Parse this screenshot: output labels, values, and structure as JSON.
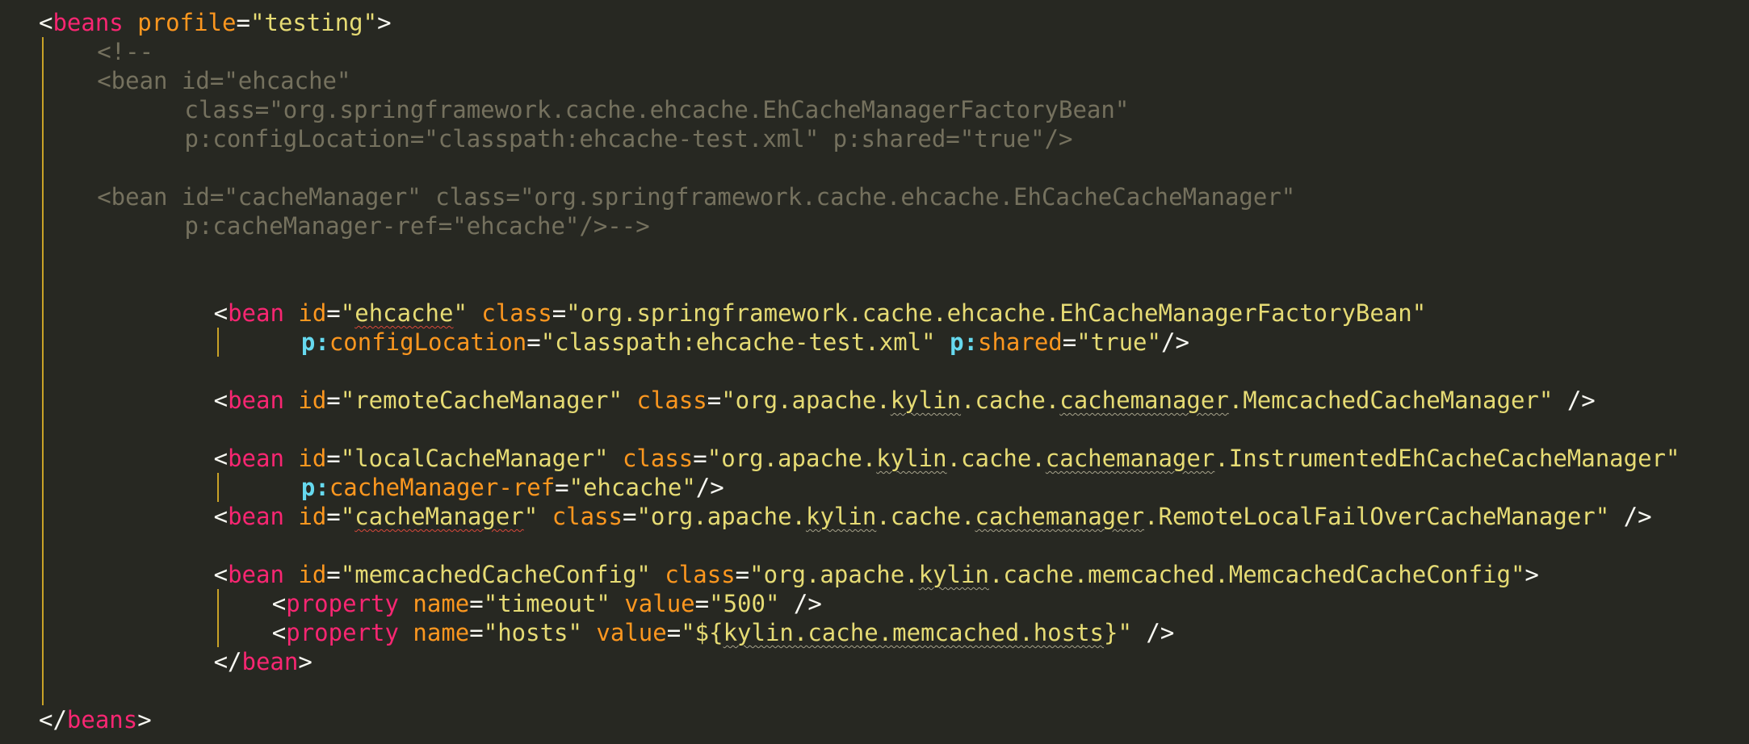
{
  "lines": [
    {
      "indent": 0,
      "tokens": [
        [
          "p",
          "<"
        ],
        [
          "t",
          "beans"
        ],
        [
          "p",
          " "
        ],
        [
          "a",
          "profile"
        ],
        [
          "p",
          "="
        ],
        [
          "s",
          "\"testing\""
        ],
        [
          "p",
          ">"
        ]
      ]
    },
    {
      "indent": 4,
      "tokens": [
        [
          "c",
          "<!--"
        ]
      ]
    },
    {
      "indent": 4,
      "tokens": [
        [
          "c",
          "<bean id=\"ehcache\""
        ]
      ]
    },
    {
      "indent": 10,
      "tokens": [
        [
          "c",
          "class=\"org.springframework.cache.ehcache.EhCacheManagerFactoryBean\""
        ]
      ]
    },
    {
      "indent": 10,
      "tokens": [
        [
          "c",
          "p:configLocation=\"classpath:ehcache-test.xml\" p:shared=\"true\"/>"
        ]
      ]
    },
    {
      "indent": 0,
      "tokens": []
    },
    {
      "indent": 4,
      "tokens": [
        [
          "c",
          "<bean id=\"cacheManager\" class=\"org.springframework.cache.ehcache.EhCacheCacheManager\""
        ]
      ]
    },
    {
      "indent": 10,
      "tokens": [
        [
          "c",
          "p:cacheManager-ref=\"ehcache\"/>-->"
        ]
      ]
    },
    {
      "indent": 0,
      "tokens": []
    },
    {
      "indent": 0,
      "tokens": []
    },
    {
      "indent": 12,
      "tokens": [
        [
          "p",
          "<"
        ],
        [
          "t",
          "bean"
        ],
        [
          "p",
          " "
        ],
        [
          "a",
          "id"
        ],
        [
          "p",
          "="
        ],
        [
          "s",
          "\""
        ],
        [
          "s sqr",
          "ehcache"
        ],
        [
          "s",
          "\""
        ],
        [
          "p",
          " "
        ],
        [
          "a",
          "class"
        ],
        [
          "p",
          "="
        ],
        [
          "s",
          "\"org.springframework.cache.ehcache.EhCacheManagerFactoryBean\""
        ]
      ]
    },
    {
      "indent": 18,
      "tokens": [
        [
          "n",
          "p:"
        ],
        [
          "a",
          "configLocation"
        ],
        [
          "p",
          "="
        ],
        [
          "s",
          "\"classpath:ehcache-test.xml\""
        ],
        [
          "p",
          " "
        ],
        [
          "n",
          "p:"
        ],
        [
          "a",
          "shared"
        ],
        [
          "p",
          "="
        ],
        [
          "s",
          "\"true\""
        ],
        [
          "p",
          "/>"
        ]
      ]
    },
    {
      "indent": 0,
      "tokens": []
    },
    {
      "indent": 12,
      "tokens": [
        [
          "p",
          "<"
        ],
        [
          "t",
          "bean"
        ],
        [
          "p",
          " "
        ],
        [
          "a",
          "id"
        ],
        [
          "p",
          "="
        ],
        [
          "s",
          "\"remoteCacheManager\""
        ],
        [
          "p",
          " "
        ],
        [
          "a",
          "class"
        ],
        [
          "p",
          "="
        ],
        [
          "s",
          "\"org.apache."
        ],
        [
          "s sq",
          "kylin"
        ],
        [
          "s",
          ".cache."
        ],
        [
          "s sq",
          "cachemanager"
        ],
        [
          "s",
          ".MemcachedCacheManager\""
        ],
        [
          "p",
          " />"
        ]
      ]
    },
    {
      "indent": 0,
      "tokens": []
    },
    {
      "indent": 12,
      "tokens": [
        [
          "p",
          "<"
        ],
        [
          "t",
          "bean"
        ],
        [
          "p",
          " "
        ],
        [
          "a",
          "id"
        ],
        [
          "p",
          "="
        ],
        [
          "s",
          "\"localCacheManager\""
        ],
        [
          "p",
          " "
        ],
        [
          "a",
          "class"
        ],
        [
          "p",
          "="
        ],
        [
          "s",
          "\"org.apache."
        ],
        [
          "s sq",
          "kylin"
        ],
        [
          "s",
          ".cache."
        ],
        [
          "s sq",
          "cachemanager"
        ],
        [
          "s",
          ".InstrumentedEhCacheCacheManager\""
        ]
      ]
    },
    {
      "indent": 18,
      "tokens": [
        [
          "n",
          "p:"
        ],
        [
          "a",
          "cacheManager-ref"
        ],
        [
          "p",
          "="
        ],
        [
          "s",
          "\"ehcache\""
        ],
        [
          "p",
          "/>"
        ]
      ]
    },
    {
      "indent": 12,
      "tokens": [
        [
          "p",
          "<"
        ],
        [
          "t",
          "bean"
        ],
        [
          "p",
          " "
        ],
        [
          "a",
          "id"
        ],
        [
          "p",
          "="
        ],
        [
          "s",
          "\""
        ],
        [
          "s sqr",
          "cacheManager"
        ],
        [
          "s",
          "\""
        ],
        [
          "p",
          " "
        ],
        [
          "a",
          "class"
        ],
        [
          "p",
          "="
        ],
        [
          "s",
          "\"org.apache."
        ],
        [
          "s sq",
          "kylin"
        ],
        [
          "s",
          ".cache."
        ],
        [
          "s sq",
          "cachemanager"
        ],
        [
          "s",
          ".RemoteLocalFailOverCacheManager\""
        ],
        [
          "p",
          " />"
        ]
      ]
    },
    {
      "indent": 0,
      "tokens": []
    },
    {
      "indent": 12,
      "tokens": [
        [
          "p",
          "<"
        ],
        [
          "t",
          "bean"
        ],
        [
          "p",
          " "
        ],
        [
          "a",
          "id"
        ],
        [
          "p",
          "="
        ],
        [
          "s",
          "\"memcachedCacheConfig\""
        ],
        [
          "p",
          " "
        ],
        [
          "a",
          "class"
        ],
        [
          "p",
          "="
        ],
        [
          "s",
          "\"org.apache."
        ],
        [
          "s sq",
          "kylin"
        ],
        [
          "s",
          ".cache.memcached.MemcachedCacheConfig\""
        ],
        [
          "p",
          ">"
        ]
      ]
    },
    {
      "indent": 16,
      "tokens": [
        [
          "p",
          "<"
        ],
        [
          "t",
          "property"
        ],
        [
          "p",
          " "
        ],
        [
          "a",
          "name"
        ],
        [
          "p",
          "="
        ],
        [
          "s",
          "\"timeout\""
        ],
        [
          "p",
          " "
        ],
        [
          "a",
          "value"
        ],
        [
          "p",
          "="
        ],
        [
          "s",
          "\"500\""
        ],
        [
          "p",
          " />"
        ]
      ]
    },
    {
      "indent": 16,
      "tokens": [
        [
          "p",
          "<"
        ],
        [
          "t",
          "property"
        ],
        [
          "p",
          " "
        ],
        [
          "a",
          "name"
        ],
        [
          "p",
          "="
        ],
        [
          "s",
          "\"hosts\""
        ],
        [
          "p",
          " "
        ],
        [
          "a",
          "value"
        ],
        [
          "p",
          "="
        ],
        [
          "s",
          "\"${"
        ],
        [
          "s sq",
          "kylin.cache.memcached.hosts"
        ],
        [
          "s",
          "}\""
        ],
        [
          "p",
          " />"
        ]
      ]
    },
    {
      "indent": 12,
      "tokens": [
        [
          "p",
          "</"
        ],
        [
          "t",
          "bean"
        ],
        [
          "p",
          ">"
        ]
      ]
    },
    {
      "indent": 0,
      "tokens": []
    },
    {
      "indent": 0,
      "tokens": [
        [
          "p",
          "</"
        ],
        [
          "t",
          "beans"
        ],
        [
          "p",
          ">"
        ]
      ]
    }
  ],
  "theme": {
    "background": "#272822",
    "tag": "#f92672",
    "attribute": "#fd971f",
    "string": "#e6db74",
    "comment": "#75715e",
    "namespace": "#66d9ef",
    "indent_guide": "#c9a227"
  }
}
